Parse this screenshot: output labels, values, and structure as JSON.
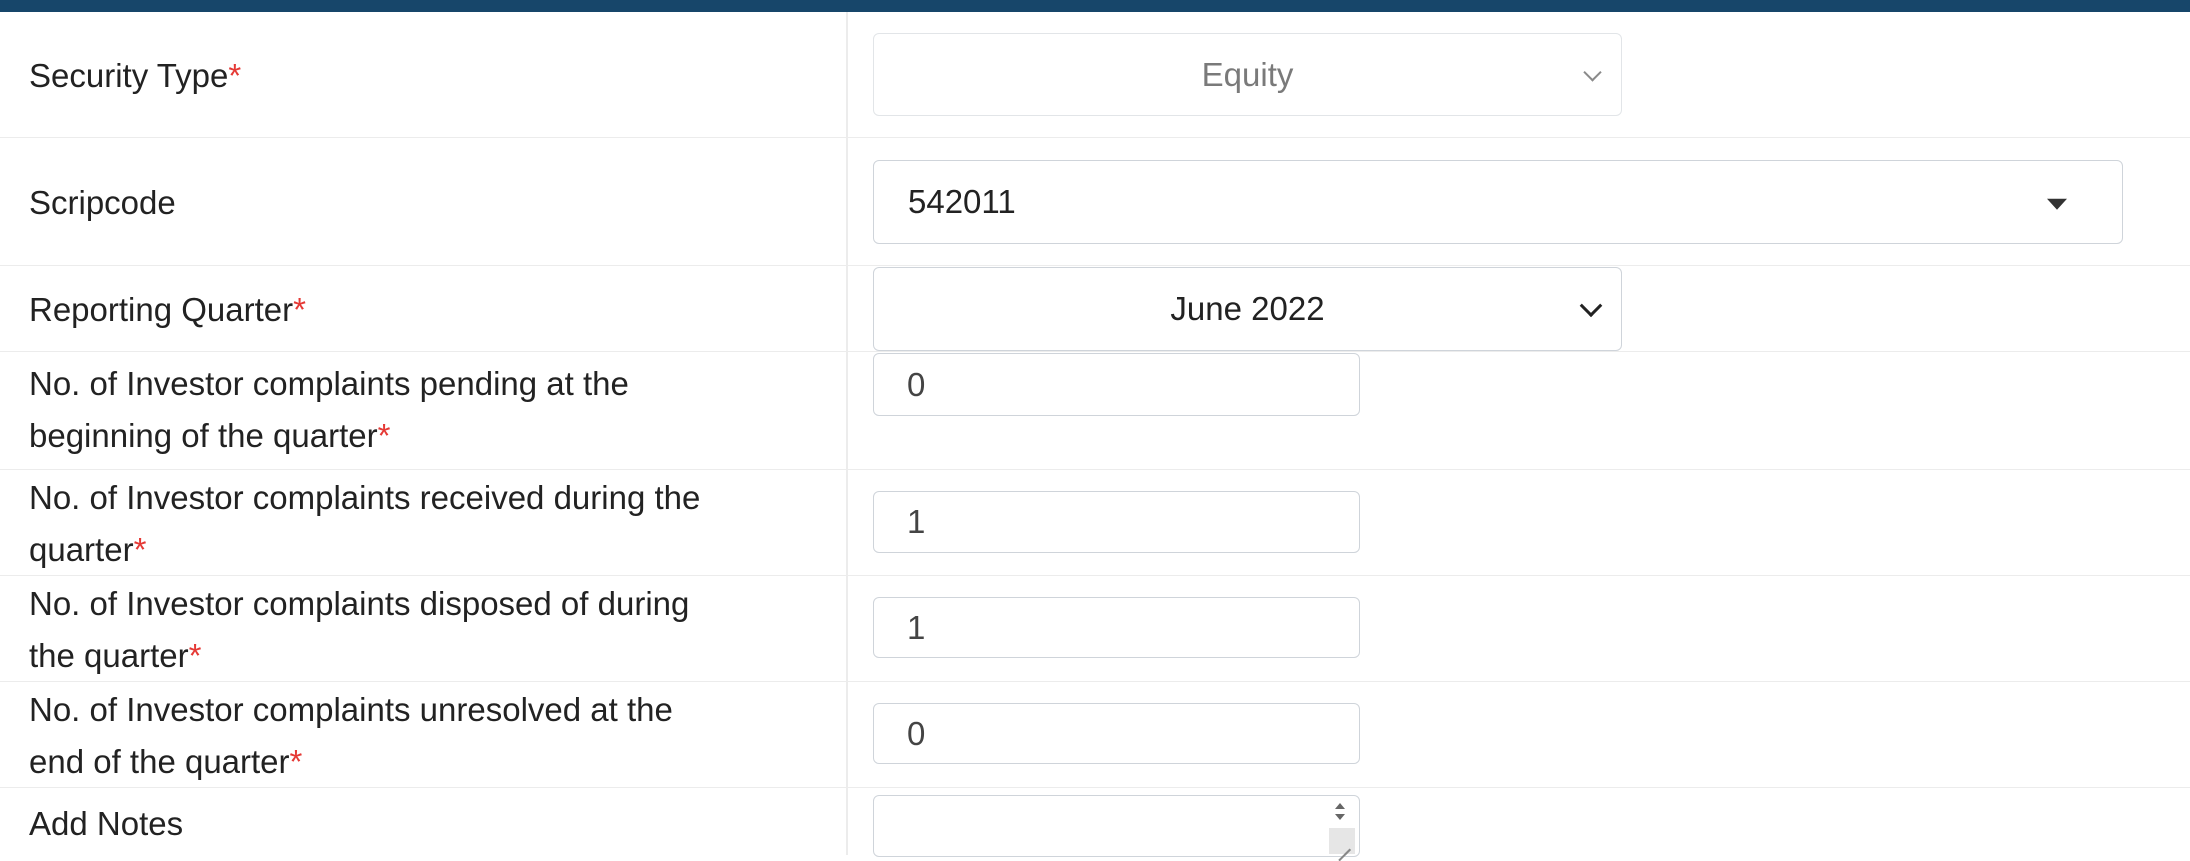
{
  "form": {
    "security_type": {
      "label": "Security Type",
      "required_mark": "*",
      "value": "Equity"
    },
    "scripcode": {
      "label": "Scripcode",
      "value": "542011"
    },
    "reporting_quarter": {
      "label": "Reporting Quarter",
      "required_mark": "*",
      "value": "June 2022"
    },
    "pending_beginning": {
      "label_line1": "No. of Investor complaints pending at the",
      "label_line2": "beginning of the quarter",
      "required_mark": "*",
      "value": "0"
    },
    "received": {
      "label_line1": "No. of Investor complaints received during the",
      "label_line2": "quarter",
      "required_mark": "*",
      "value": "1"
    },
    "disposed": {
      "label_line1": "No. of Investor complaints disposed of during",
      "label_line2": "the quarter",
      "required_mark": "*",
      "value": "1"
    },
    "unresolved_end": {
      "label_line1": "No. of Investor complaints unresolved at the",
      "label_line2": "end of the quarter",
      "required_mark": "*",
      "value": "0"
    },
    "add_notes": {
      "label": "Add Notes",
      "value": ""
    }
  },
  "colors": {
    "header_bar": "#17466a",
    "required_mark": "#e53935",
    "border": "#cfd4da",
    "row_divider": "#ececec"
  },
  "icons": {
    "security_type_dropdown": "chevron-down-icon",
    "scripcode_dropdown": "caret-down-icon",
    "reporting_quarter_dropdown": "chevron-down-icon",
    "notes_spinner": "spinner-arrows-icon",
    "notes_resize": "resize-handle-icon"
  }
}
